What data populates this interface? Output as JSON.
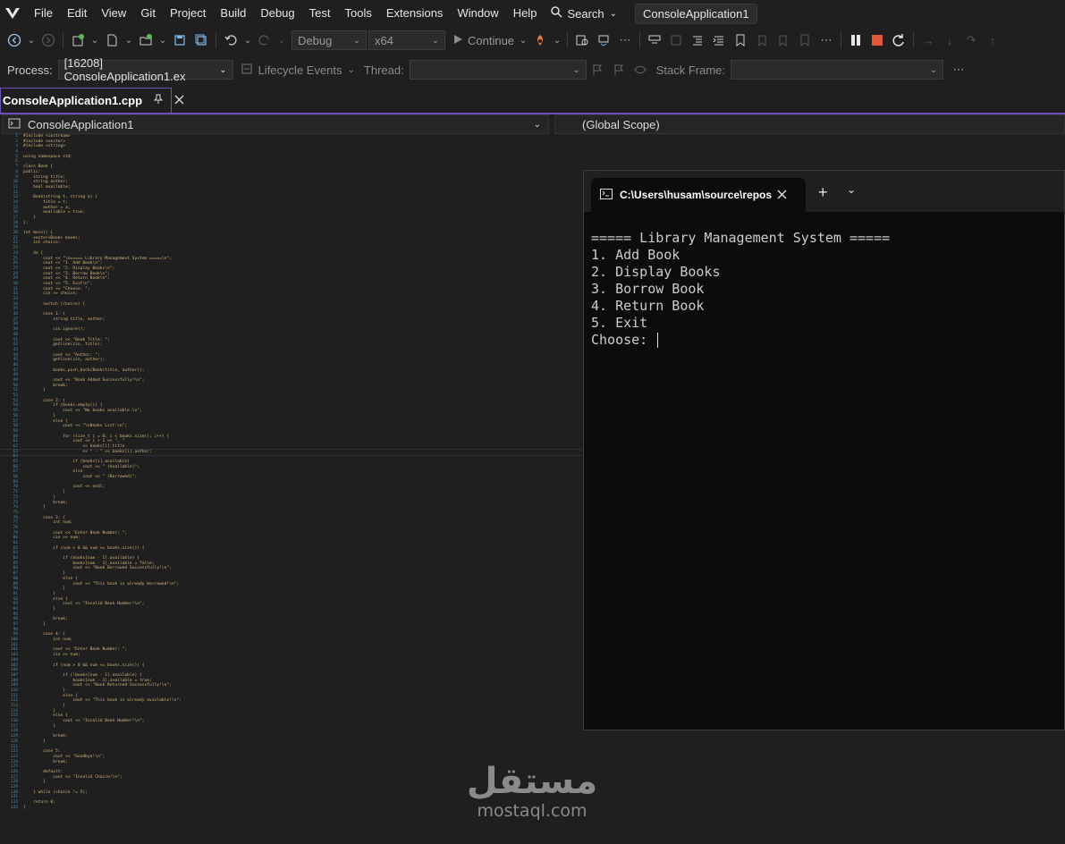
{
  "menubar": {
    "items": [
      "File",
      "Edit",
      "View",
      "Git",
      "Project",
      "Build",
      "Debug",
      "Test",
      "Tools",
      "Extensions",
      "Window",
      "Help"
    ],
    "search_label": "Search",
    "solution_title": "ConsoleApplication1"
  },
  "toolbar": {
    "configuration": "Debug",
    "platform": "x64",
    "continue_label": "Continue"
  },
  "debug_location": {
    "process_label": "Process:",
    "process_value": "[16208] ConsoleApplication1.ex",
    "lifecycle_label": "Lifecycle Events",
    "thread_label": "Thread:",
    "thread_value": "",
    "stack_frame_label": "Stack Frame:",
    "stack_frame_value": ""
  },
  "editor_tab": {
    "filename": "ConsoleApplication1.cpp"
  },
  "navbar": {
    "project": "ConsoleApplication1",
    "scope": "(Global Scope)"
  },
  "code": [
    "#include <iostream>",
    "#include <vector>",
    "#include <string>",
    "",
    "using namespace std;",
    "",
    "class Book {",
    "public:",
    "    string title;",
    "    string author;",
    "    bool available;",
    "",
    "    Book(string t, string a) {",
    "        title = t;",
    "        author = a;",
    "        available = true;",
    "    }",
    "};",
    "",
    "int main() {",
    "    vector<Book> books;",
    "    int choice;",
    "",
    "    do {",
    "        cout << \"\\n===== Library Management System =====\\n\";",
    "        cout << \"1. Add Book\\n\";",
    "        cout << \"2. Display Books\\n\";",
    "        cout << \"3. Borrow Book\\n\";",
    "        cout << \"4. Return Book\\n\";",
    "        cout << \"5. Exit\\n\";",
    "        cout << \"Choose: \";",
    "        cin >> choice;",
    "",
    "        switch (choice) {",
    "",
    "        case 1: {",
    "            string title, author;",
    "",
    "            cin.ignore();",
    "",
    "            cout << \"Book Title: \";",
    "            getline(cin, title);",
    "",
    "            cout << \"Author: \";",
    "            getline(cin, author);",
    "",
    "            books.push_back(Book(title, author));",
    "",
    "            cout << \"Book Added Successfully!\\n\";",
    "            break;",
    "        }",
    "",
    "        case 2: {",
    "            if (books.empty()) {",
    "                cout << \"No books available.\\n\";",
    "            }",
    "            else {",
    "                cout << \"\\nBooks List:\\n\";",
    "",
    "                for (size_t i = 0; i < books.size(); i++) {",
    "                    cout << i + 1 << \". \"",
    "                        << books[i].title",
    "                        << \" - \" << books[i].author;",
    "",
    "                    if (books[i].available)",
    "                        cout << \" (Available)\";",
    "                    else",
    "                        cout << \" (Borrowed)\";",
    "",
    "                    cout << endl;",
    "                }",
    "            }",
    "            break;",
    "        }",
    "",
    "        case 3: {",
    "            int num;",
    "",
    "            cout << \"Enter Book Number: \";",
    "            cin >> num;",
    "",
    "            if (num > 0 && num <= books.size()) {",
    "",
    "                if (books[num - 1].available) {",
    "                    books[num - 1].available = false;",
    "                    cout << \"Book Borrowed Successfully!\\n\";",
    "                }",
    "                else {",
    "                    cout << \"This book is already borrowed!\\n\";",
    "                }",
    "            }",
    "            else {",
    "                cout << \"Invalid Book Number!\\n\";",
    "            }",
    "",
    "            break;",
    "        }",
    "",
    "        case 4: {",
    "            int num;",
    "",
    "            cout << \"Enter Book Number: \";",
    "            cin >> num;",
    "",
    "            if (num > 0 && num <= books.size()) {",
    "",
    "                if (!books[num - 1].available) {",
    "                    books[num - 1].available = true;",
    "                    cout << \"Book Returned Successfully!\\n\";",
    "                }",
    "                else {",
    "                    cout << \"This book is already available!\\n\";",
    "                }",
    "            }",
    "            else {",
    "                cout << \"Invalid Book Number!\\n\";",
    "            }",
    "",
    "            break;",
    "        }",
    "",
    "        case 5:",
    "            cout << \"Goodbye!\\n\";",
    "            break;",
    "",
    "        default:",
    "            cout << \"Invalid Choice!\\n\";",
    "        }",
    "",
    "    } while (choice != 5);",
    "",
    "    return 0;",
    "}"
  ],
  "terminal": {
    "tab_title": "C:\\Users\\husam\\source\\repos",
    "lines": [
      "===== Library Management System =====",
      "1. Add Book",
      "2. Display Books",
      "3. Borrow Book",
      "4. Return Book",
      "5. Exit",
      "Choose: "
    ]
  },
  "watermark": {
    "arabic": "مستقل",
    "latin": "mostaql.com"
  },
  "colors": {
    "accent": "#6f4fbf",
    "stop": "#e05a3a",
    "background": "#1f1f1f"
  }
}
